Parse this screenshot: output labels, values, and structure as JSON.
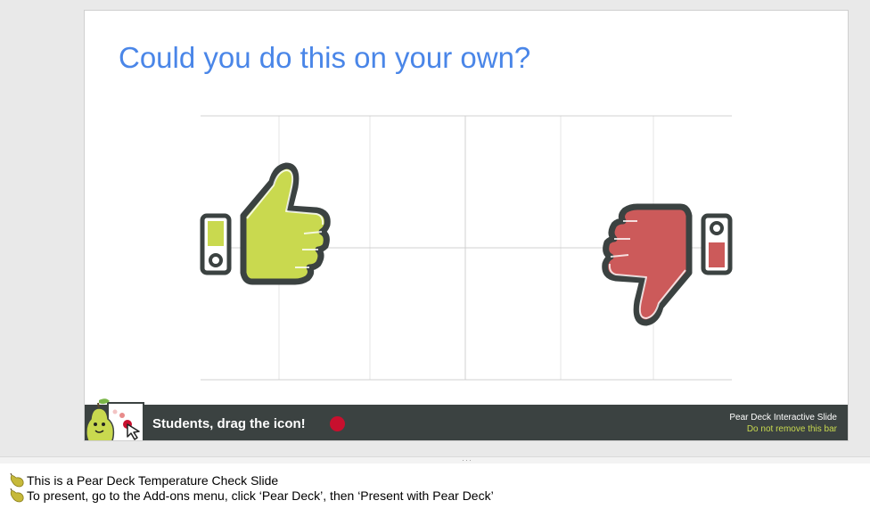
{
  "slide": {
    "title": "Could you do this on your own?"
  },
  "peardeck_bar": {
    "drag_text": "Students, drag the icon!",
    "interactive_label": "Pear Deck Interactive Slide",
    "warning_label": "Do not remove this bar"
  },
  "icons": {
    "thumbs_up": "thumbs-up-icon",
    "thumbs_down": "thumbs-down-icon",
    "pear_logo": "pear-logo-icon",
    "drag_cursor": "cursor-icon"
  },
  "colors": {
    "title": "#4a86e8",
    "thumbs_up": "#c9d94f",
    "thumbs_down": "#cc5a5a",
    "bar": "#3b4241",
    "dot": "#c8102e",
    "warning": "#c8d94f"
  },
  "resize_grip": "···",
  "speaker_notes": [
    {
      "text": "This is a Pear Deck Temperature Check Slide"
    },
    {
      "text": "To present, go to the Add-ons menu, click ‘Pear Deck’, then ‘Present with Pear Deck’"
    }
  ]
}
